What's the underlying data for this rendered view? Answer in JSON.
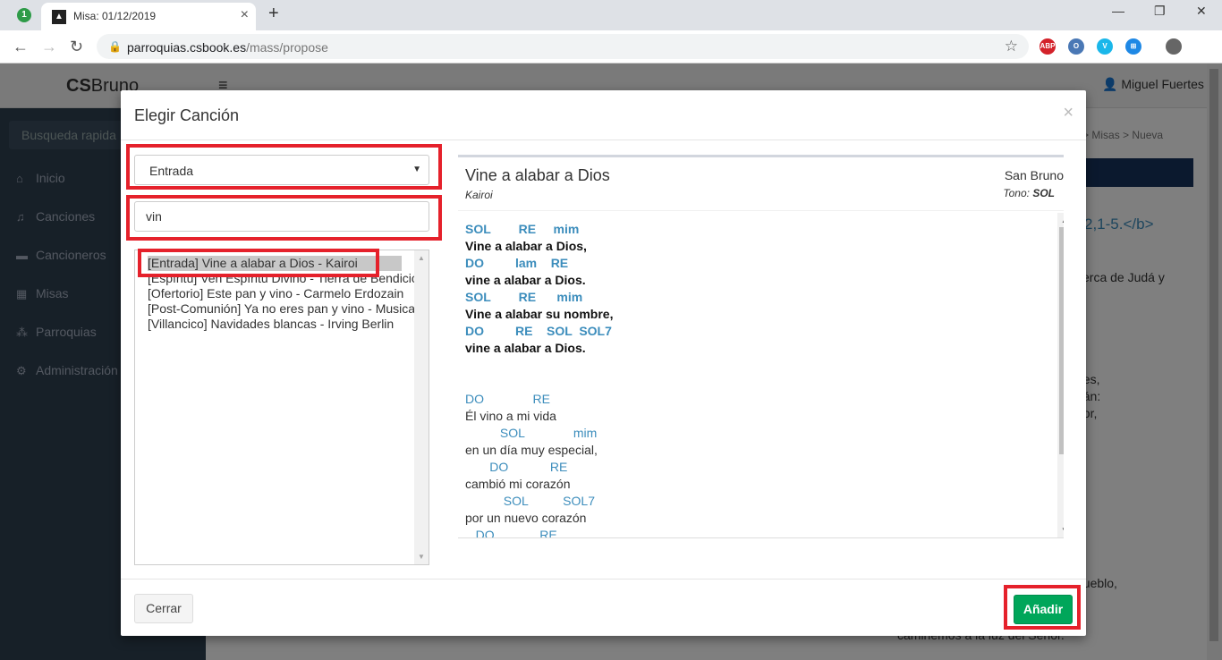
{
  "browser": {
    "tab_badge": "1",
    "tab_title": "Misa: 01/12/2019",
    "url_domain": "parroquias.csbook.es",
    "url_path": "/mass/propose",
    "extensions": [
      {
        "name": "abp-icon",
        "label": "ABP",
        "color": "#d3222a"
      },
      {
        "name": "extension-o-icon",
        "label": "O",
        "color": "#4a78b5"
      },
      {
        "name": "vimeo-icon",
        "label": "V",
        "color": "#1ab7ea"
      },
      {
        "name": "windows-icon",
        "label": "⊞",
        "color": "#1e88e5"
      },
      {
        "name": "profile-avatar-icon",
        "label": "",
        "color": "#666666"
      }
    ]
  },
  "app": {
    "brand_bold": "CS",
    "brand_rest": "Bruno",
    "user_name": "Miguel Fuertes",
    "sidebar": {
      "search_placeholder": "Busqueda rapida",
      "items": [
        {
          "label": "Inicio",
          "icon": "home-icon",
          "glyph": "⌂"
        },
        {
          "label": "Canciones",
          "icon": "music-icon",
          "glyph": "♫"
        },
        {
          "label": "Cancioneros",
          "icon": "book-icon",
          "glyph": "▬"
        },
        {
          "label": "Misas",
          "icon": "calendar-icon",
          "glyph": "▦"
        },
        {
          "label": "Parroquias",
          "icon": "sitemap-icon",
          "glyph": "⁂"
        },
        {
          "label": "Administración",
          "icon": "gear-icon",
          "glyph": "⚙"
        }
      ]
    },
    "breadcrumb": [
      "o",
      "Misas",
      "Nueva"
    ],
    "page_text": [
      "2,1-5.</b>",
      "cerca de Judá y",
      "nes,",
      "irán:",
      "ñor,",
      "».",
      "s.",
      "pueblo,",
      "caminemos a la luz del Señor."
    ]
  },
  "modal": {
    "title": "Elegir Canción",
    "close_glyph": "×",
    "category_value": "Entrada",
    "search_value": "vin",
    "search_placeholder": "",
    "results": [
      "[Entrada] Vine a alabar a Dios - Kairoi",
      "[Espíritu] Ven Espíritu Divino - Tierra de Bendición",
      "[Ofertorio] Este pan y vino - Carmelo Erdozain",
      "[Post-Comunión] Ya no eres pan y vino - Musicales",
      "[Villancico] Navidades blancas - Irving Berlin"
    ],
    "song": {
      "title": "Vine a alabar a Dios",
      "author": "Kairoi",
      "parish": "San Bruno",
      "key_label": "Tono:",
      "key_value": "SOL",
      "lines": [
        {
          "type": "chord",
          "bold": true,
          "text": "SOL        RE     mim"
        },
        {
          "type": "lyric",
          "bold": true,
          "text": "Vine a alabar a Dios,"
        },
        {
          "type": "chord",
          "bold": true,
          "text": "DO         lam    RE"
        },
        {
          "type": "lyric",
          "bold": true,
          "text": "vine a alabar a Dios."
        },
        {
          "type": "chord",
          "bold": true,
          "text": "SOL        RE      mim"
        },
        {
          "type": "lyric",
          "bold": true,
          "text": "Vine a alabar su nombre,"
        },
        {
          "type": "chord",
          "bold": true,
          "text": "DO         RE    SOL  SOL7"
        },
        {
          "type": "lyric",
          "bold": true,
          "text": "vine a alabar a Dios."
        },
        {
          "type": "blank",
          "bold": false,
          "text": ""
        },
        {
          "type": "blank",
          "bold": false,
          "text": ""
        },
        {
          "type": "chord",
          "bold": false,
          "text": "DO              RE"
        },
        {
          "type": "lyric",
          "bold": false,
          "text": "Él vino a mi vida"
        },
        {
          "type": "chord",
          "bold": false,
          "text": "          SOL              mim"
        },
        {
          "type": "lyric",
          "bold": false,
          "text": "en un día muy especial,"
        },
        {
          "type": "chord",
          "bold": false,
          "text": "       DO            RE"
        },
        {
          "type": "lyric",
          "bold": false,
          "text": "cambió mi corazón"
        },
        {
          "type": "chord",
          "bold": false,
          "text": "           SOL          SOL7"
        },
        {
          "type": "lyric",
          "bold": false,
          "text": "por un nuevo corazón"
        },
        {
          "type": "chord",
          "bold": false,
          "text": "   DO             RE"
        }
      ]
    },
    "close_button": "Cerrar",
    "add_button": "Añadir"
  },
  "colors": {
    "accent_green": "#00a65a",
    "chord_blue": "#3c8dbc",
    "highlight_red": "#e5212b",
    "sidebar_bg": "#2f4050"
  }
}
